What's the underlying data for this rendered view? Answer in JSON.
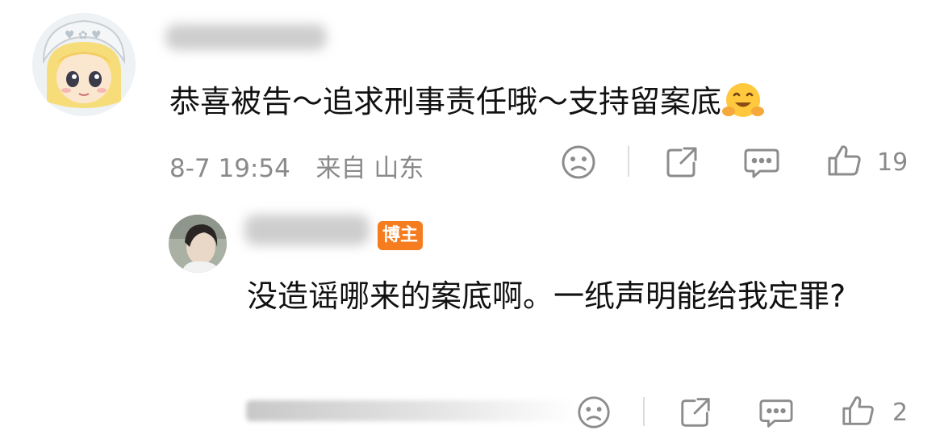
{
  "comment": {
    "text": "恭喜被告～追求刑事责任哦～支持留案底",
    "emoji": "hugging-face",
    "date": "8-7 19:54",
    "source": "来自 山东",
    "like_count": "19"
  },
  "reply": {
    "badge": "博主",
    "text": "没造谣哪来的案底啊。一纸声明能给我定罪?",
    "like_count": "2"
  },
  "colors": {
    "badge": "#f57c1f",
    "meta_gray": "#8a8a8a",
    "icon_gray": "#8c8c8c"
  }
}
